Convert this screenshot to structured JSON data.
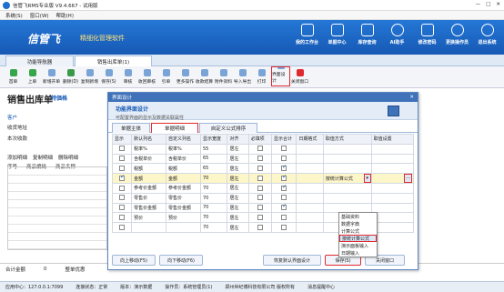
{
  "app": {
    "title": "信管飞RMS专业版 V9.4.667 - 试用版",
    "window_controls": [
      "—",
      "□",
      "✕"
    ]
  },
  "menu": [
    "系统(S)",
    "窗口(W)",
    "帮助(H)"
  ],
  "banner": {
    "brand": "信管飞",
    "slogan": "精细化管理软件",
    "tools": [
      "我的工作台",
      "单据中心",
      "库存查询",
      "AI助手",
      "修改密码",
      "更换操作员",
      "退出系统"
    ]
  },
  "tabs": [
    "功能导航器",
    "销售出库单(1)"
  ],
  "toolbar": [
    "首单",
    "上单",
    "新增开单",
    "删除(D)",
    "复制新增",
    "保存(S)",
    "审核",
    "收回审核",
    "引单",
    "更多操作",
    "收款结算",
    "附件资料",
    "导入导出",
    "打印",
    "界面设计",
    "关闭窗口"
  ],
  "doc": {
    "title": "销售出库单",
    "subtitle": "特価格",
    "labels": [
      "客户",
      "收货地址",
      "本次收款"
    ],
    "actions": [
      "添加明细",
      "复制明细",
      "删除明细"
    ],
    "columns": [
      "序号",
      "商品编码",
      "商品名称"
    ],
    "footer": [
      "合计金额",
      "0",
      "整单优惠"
    ]
  },
  "dialog": {
    "title": "界面设计",
    "info_title": "功能界面设计",
    "info_desc": "可配置界面的显示及数据关联属性",
    "tabs": [
      "单据主体",
      "单据明细",
      "自定义公式排序"
    ],
    "columns": [
      "显示",
      "默认列名",
      "自定义列名",
      "显示宽度",
      "对齐",
      "必填项",
      "显示合计",
      "日期格式",
      "取值方式",
      "取值设置"
    ],
    "rows": [
      {
        "show": false,
        "name": "税率%",
        "custom": "税率%",
        "width": "55",
        "align": "居左",
        "required": false,
        "total": false
      },
      {
        "show": false,
        "name": "含税单价",
        "custom": "含税单价",
        "width": "65",
        "align": "居左",
        "required": false,
        "total": false
      },
      {
        "show": false,
        "name": "税额",
        "custom": "税额",
        "width": "65",
        "align": "居左",
        "required": false,
        "total": true
      },
      {
        "show": true,
        "name": "金额",
        "custom": "金额",
        "width": "70",
        "align": "居左",
        "required": false,
        "total": true,
        "mode": "按统计算公式"
      },
      {
        "show": false,
        "name": "参考价金额",
        "custom": "参考价金额",
        "width": "70",
        "align": "居左",
        "required": false,
        "total": true
      },
      {
        "show": false,
        "name": "零售价",
        "custom": "零售价",
        "width": "70",
        "align": "居左",
        "required": false,
        "total": false
      },
      {
        "show": false,
        "name": "零售价金额",
        "custom": "零售价金额",
        "width": "70",
        "align": "居左",
        "required": false,
        "total": true
      },
      {
        "show": false,
        "name": "预价",
        "custom": "预价",
        "width": "70",
        "align": "居左",
        "required": false,
        "total": false
      },
      {
        "show": false,
        "name": "",
        "custom": "",
        "width": "70",
        "align": "居左",
        "required": false,
        "total": false
      }
    ],
    "dropdown": [
      "基础资料",
      "数据字典",
      "计算公式",
      "按统计算公式",
      "演示面板输入",
      "日期输入"
    ],
    "buttons": [
      "向上移动(F5)",
      "向下移动(F6)",
      "恢复默认界面设计",
      "保存(S)",
      "关闭窗口"
    ]
  },
  "status": [
    "应用中心：127.0.0.1:7099",
    "连接状态：正常",
    "版本：演示数据",
    "操作员：系统管理员(1)",
    "郑州世纪博科技有限公司 版权所有",
    "消息提醒中心"
  ]
}
